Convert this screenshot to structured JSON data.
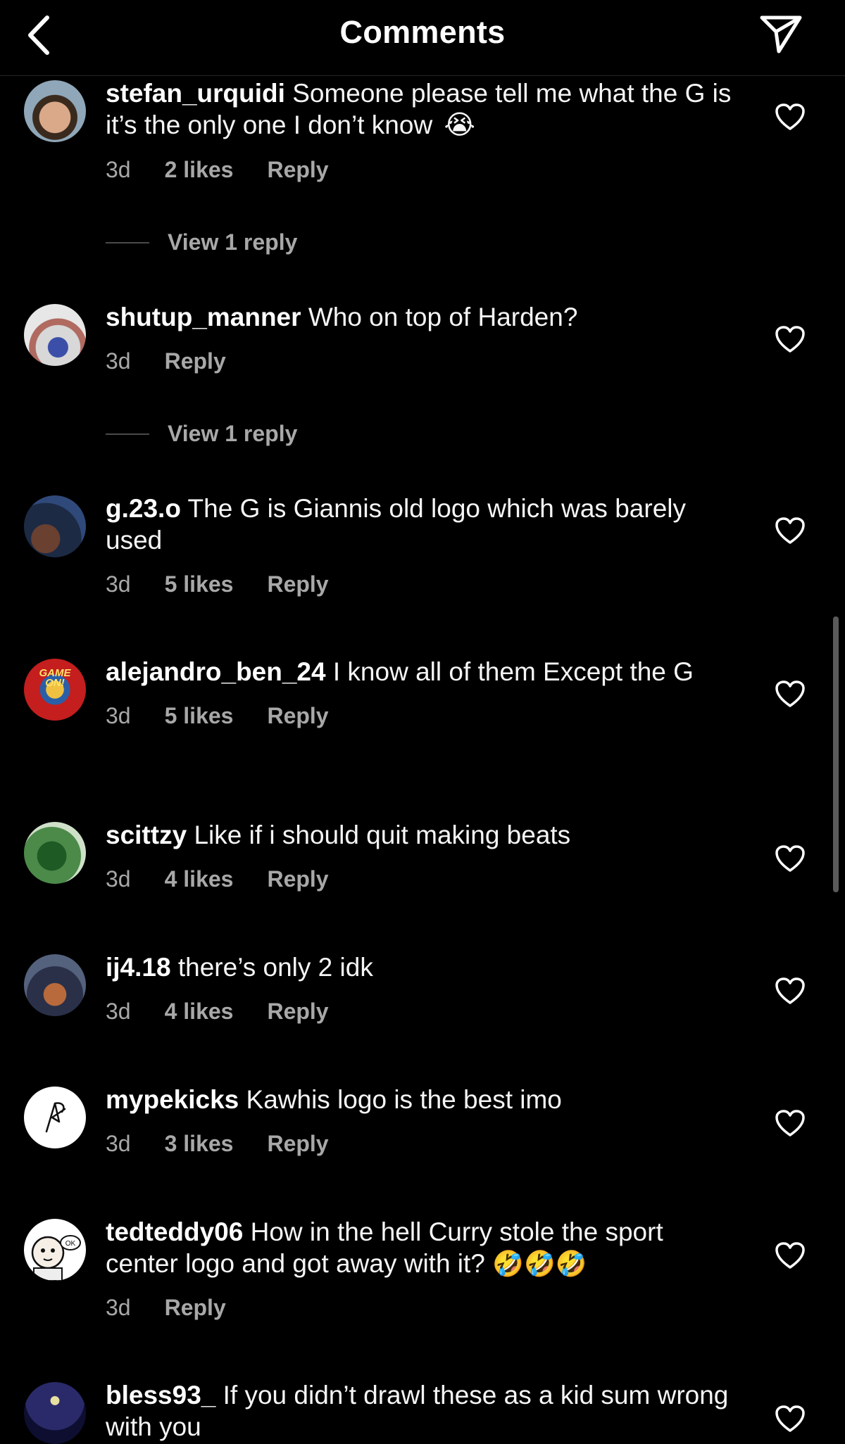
{
  "header": {
    "title": "Comments",
    "back_icon": "chevron-left-icon",
    "share_icon": "send-icon"
  },
  "comments": [
    {
      "username": "stefan_urquidi",
      "text": "Someone please tell me what the G is it’s the only one I don’t know",
      "emoji": "😭",
      "time": "3d",
      "likes": "2 likes",
      "reply": "Reply",
      "view_replies": "View 1 reply"
    },
    {
      "username": "shutup_manner",
      "text": "Who on top of Harden?",
      "time": "3d",
      "reply": "Reply",
      "view_replies": "View 1 reply"
    },
    {
      "username": "g.23.o",
      "text": "The G is Giannis old logo which was barely used",
      "time": "3d",
      "likes": "5 likes",
      "reply": "Reply"
    },
    {
      "username": "alejandro_ben_24",
      "text": "I know all of them Except the G",
      "time": "3d",
      "likes": "5 likes",
      "reply": "Reply",
      "avatar_text": "GAME ON!"
    },
    {
      "username": "scittzy",
      "text": "Like if i should quit making beats",
      "time": "3d",
      "likes": "4 likes",
      "reply": "Reply"
    },
    {
      "username": "ij4.18",
      "text": "there’s only 2 idk",
      "time": "3d",
      "likes": "4 likes",
      "reply": "Reply"
    },
    {
      "username": "mypekicks",
      "text": "Kawhis logo is the best imo",
      "time": "3d",
      "likes": "3 likes",
      "reply": "Reply"
    },
    {
      "username": "tedteddy06",
      "text": "How in the hell Curry stole the sport center logo and got away with it?",
      "emoji": "🤣🤣🤣",
      "time": "3d",
      "reply": "Reply",
      "avatar_text": "OK"
    },
    {
      "username": "bless93_",
      "text": "If you didn’t drawl these as a kid sum wrong with you"
    }
  ],
  "colors": {
    "background": "#000000",
    "primary_text": "#ffffff",
    "secondary_text": "#a8a8a8"
  }
}
